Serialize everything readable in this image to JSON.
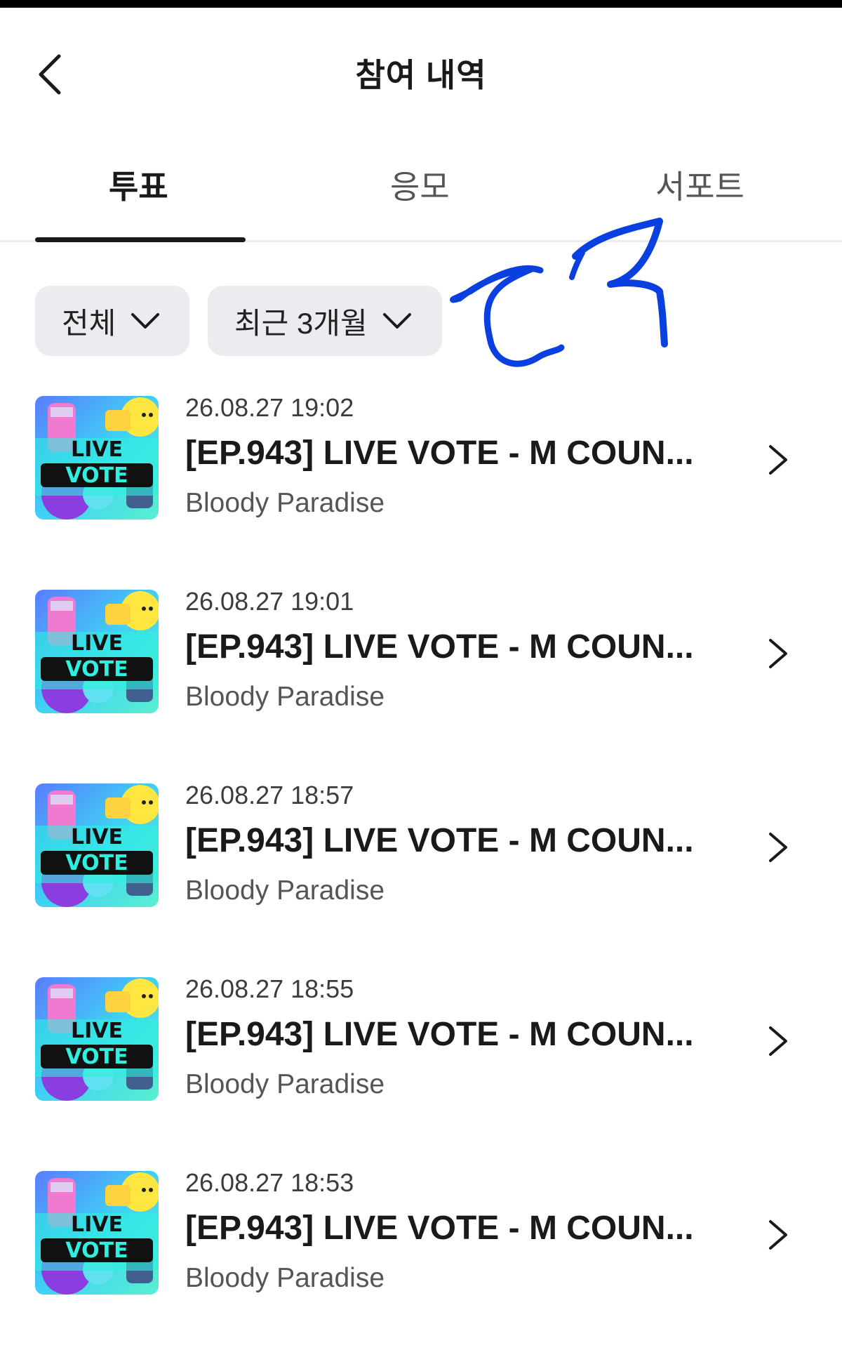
{
  "header": {
    "back_icon": "chevron-left-icon",
    "title": "참여 내역"
  },
  "tabs": [
    {
      "label": "투표",
      "active": true
    },
    {
      "label": "응모",
      "active": false
    },
    {
      "label": "서포트",
      "active": false
    }
  ],
  "filters": {
    "category": "전체",
    "period": "최근 3개월"
  },
  "items": [
    {
      "date": "26.08.27 19:02",
      "title": "[EP.943] LIVE VOTE - M COUN...",
      "artist": "Bloody Paradise"
    },
    {
      "date": "26.08.27 19:01",
      "title": "[EP.943] LIVE VOTE - M COUN...",
      "artist": "Bloody Paradise"
    },
    {
      "date": "26.08.27 18:57",
      "title": "[EP.943] LIVE VOTE - M COUN...",
      "artist": "Bloody Paradise"
    },
    {
      "date": "26.08.27 18:55",
      "title": "[EP.943] LIVE VOTE - M COUN...",
      "artist": "Bloody Paradise"
    },
    {
      "date": "26.08.27 18:53",
      "title": "[EP.943] LIVE VOTE - M COUN...",
      "artist": "Bloody Paradise"
    }
  ],
  "thumbnail": {
    "line1": "LIVE",
    "line2": "VOTE"
  },
  "colors": {
    "text_primary": "#1a1a1a",
    "chip_background": "#ececf0",
    "scribble": "#0a3fe0"
  }
}
